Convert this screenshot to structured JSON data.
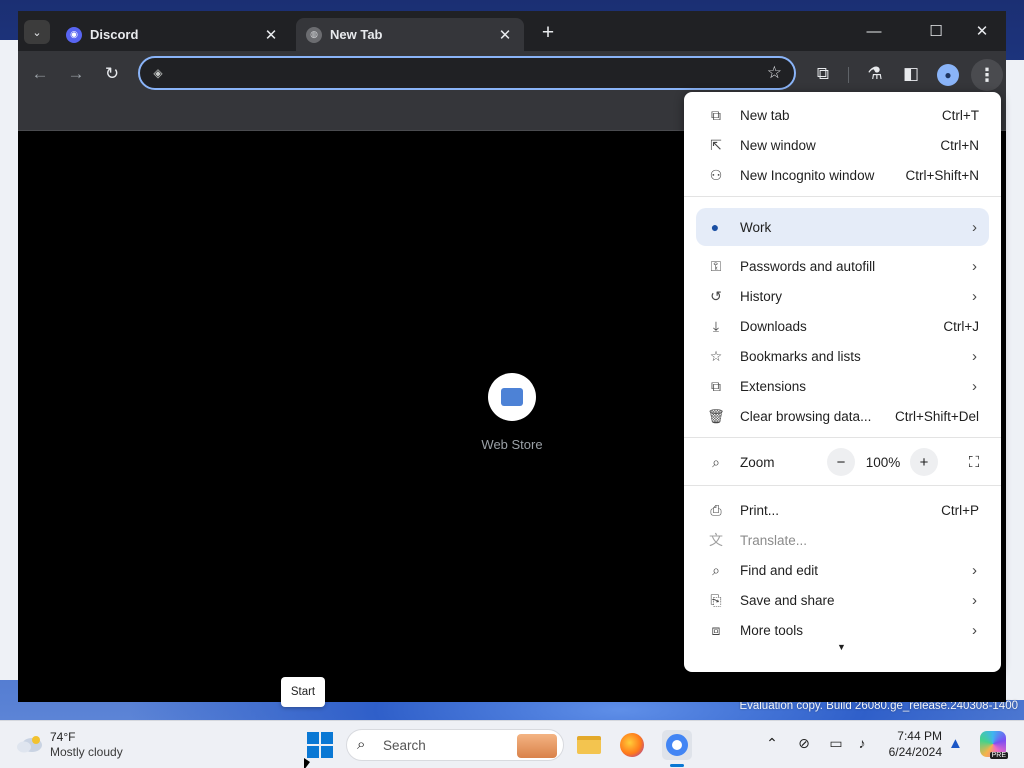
{
  "browser": {
    "tabs": [
      {
        "title": "Discord",
        "favicon": "discord-icon",
        "active": false
      },
      {
        "title": "New Tab",
        "favicon": "globe-icon",
        "active": true
      }
    ],
    "omnibox": {
      "value": "",
      "placeholder": ""
    },
    "ntp": {
      "shortcut_label": "Web Store"
    }
  },
  "menu": {
    "new_tab": {
      "label": "New tab",
      "shortcut": "Ctrl+T"
    },
    "new_window": {
      "label": "New window",
      "shortcut": "Ctrl+N"
    },
    "incognito": {
      "label": "New Incognito window",
      "shortcut": "Ctrl+Shift+N"
    },
    "profile": {
      "label": "Work"
    },
    "passwords": {
      "label": "Passwords and autofill"
    },
    "history": {
      "label": "History"
    },
    "downloads": {
      "label": "Downloads",
      "shortcut": "Ctrl+J"
    },
    "bookmarks": {
      "label": "Bookmarks and lists"
    },
    "extensions": {
      "label": "Extensions"
    },
    "clear_data": {
      "label": "Clear browsing data...",
      "shortcut": "Ctrl+Shift+Del"
    },
    "zoom": {
      "label": "Zoom",
      "value": "100%",
      "minus": "−",
      "plus": "+"
    },
    "print": {
      "label": "Print...",
      "shortcut": "Ctrl+P"
    },
    "translate": {
      "label": "Translate..."
    },
    "find_edit": {
      "label": "Find and edit"
    },
    "save_share": {
      "label": "Save and share"
    },
    "more_tools": {
      "label": "More tools"
    }
  },
  "tooltip": {
    "text": "Start"
  },
  "desktop": {
    "watermark": "Evaluation copy. Build 26080.ge_release.240308-1400"
  },
  "taskbar": {
    "weather": {
      "temp": "74°F",
      "condition": "Mostly cloudy"
    },
    "search": {
      "label": "Search"
    },
    "clock": {
      "time": "7:44 PM",
      "date": "6/24/2024"
    },
    "copilot_badge": "PRE"
  },
  "colors": {
    "accent": "#8ab4f8",
    "menu_highlight": "#e5ecf8",
    "taskbar_accent": "#0a78d4"
  }
}
